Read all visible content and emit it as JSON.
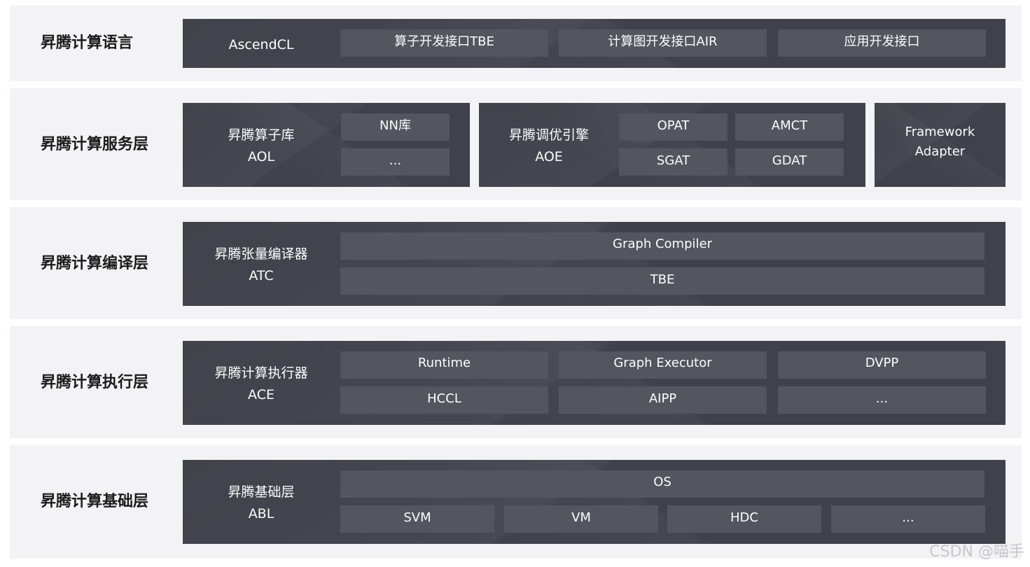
{
  "layers": {
    "lang": {
      "title": "昇腾计算语言",
      "main_label": "AscendCL",
      "boxes": [
        "算子开发接口TBE",
        "计算图开发接口AIR",
        "应用开发接口"
      ]
    },
    "service": {
      "title": "昇腾计算服务层",
      "aol": {
        "line1": "昇腾算子库",
        "line2": "AOL",
        "boxes": [
          "NN库",
          "..."
        ]
      },
      "aoe": {
        "line1": "昇腾调优引擎",
        "line2": "AOE",
        "boxes": [
          "OPAT",
          "AMCT",
          "SGAT",
          "GDAT"
        ]
      },
      "framework": {
        "line1": "Framework",
        "line2": "Adapter"
      }
    },
    "compile": {
      "title": "昇腾计算编译层",
      "line1": "昇腾张量编译器",
      "line2": "ATC",
      "boxes": [
        "Graph Compiler",
        "TBE"
      ]
    },
    "exec": {
      "title": "昇腾计算执行层",
      "line1": "昇腾计算执行器",
      "line2": "ACE",
      "boxes": [
        "Runtime",
        "Graph Executor",
        "DVPP",
        "HCCL",
        "AIPP",
        "..."
      ]
    },
    "base": {
      "title": "昇腾计算基础层",
      "line1": "昇腾基础层",
      "line2": "ABL",
      "top_box": "OS",
      "boxes": [
        "SVM",
        "VM",
        "HDC",
        "..."
      ]
    }
  },
  "watermark": "CSDN @喵手"
}
